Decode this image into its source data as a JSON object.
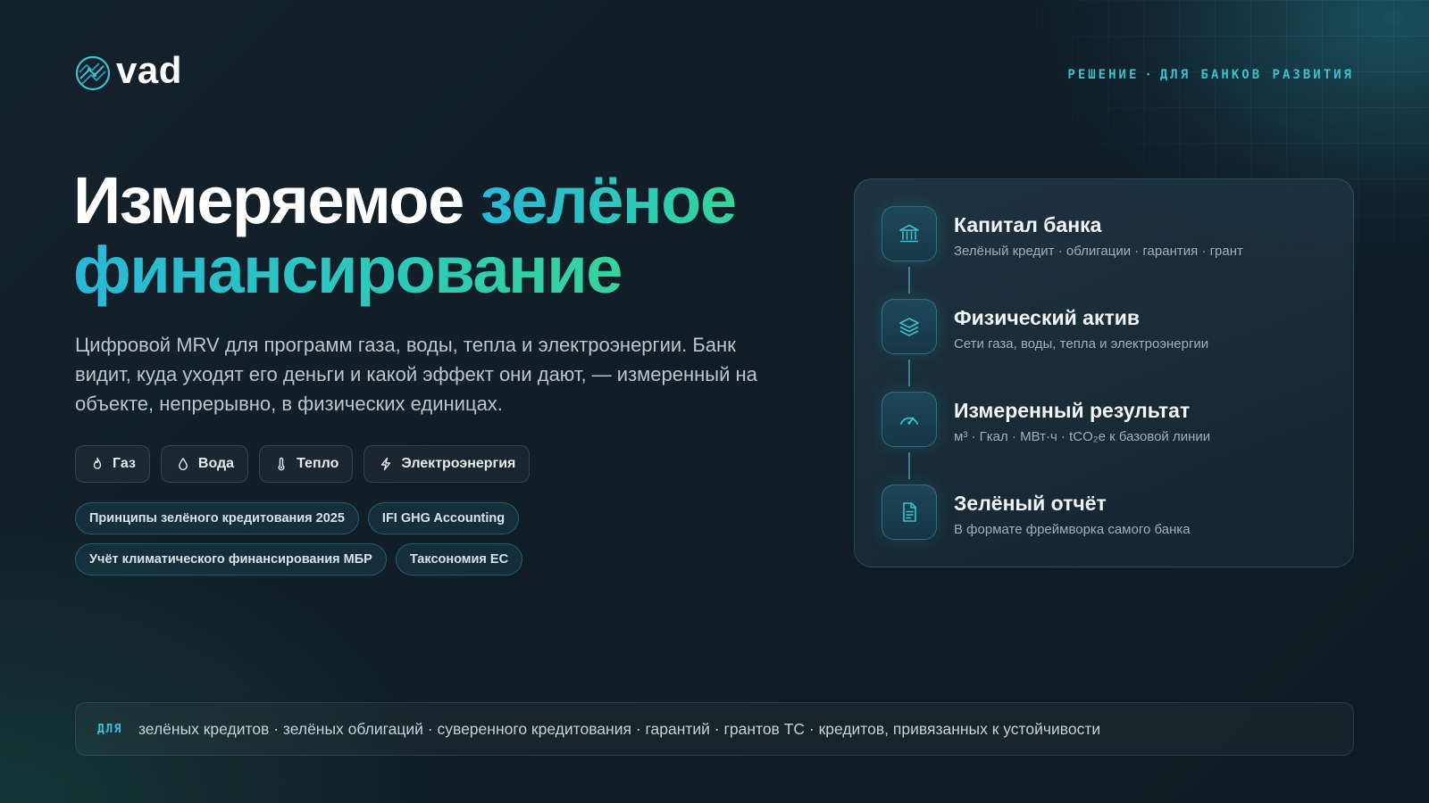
{
  "brand": {
    "name": "vad",
    "icon": "globe-network-icon"
  },
  "header": {
    "tag_left": "РЕШЕНИЕ",
    "tag_sep": "·",
    "tag_right": "ДЛЯ БАНКОВ РАЗВИТИЯ"
  },
  "hero": {
    "title_white": "Измеряемое ",
    "title_accent_1": "зелёное",
    "title_accent_2": "финансирование",
    "lead": "Цифровой MRV для программ газа, воды, тепла и электроэнергии. Банк видит, куда уходят его деньги и какой эффект они дают, — измеренный на объекте, непрерывно, в физических единицах."
  },
  "resources": [
    {
      "label": "Газ",
      "icon": "flame-icon"
    },
    {
      "label": "Вода",
      "icon": "droplet-icon"
    },
    {
      "label": "Тепло",
      "icon": "thermometer-icon"
    },
    {
      "label": "Электроэнергия",
      "icon": "lightning-icon"
    }
  ],
  "standards": [
    "Принципы зелёного кредитования 2025",
    "IFI GHG Accounting",
    "Учёт климатического финансирования МБР",
    "Таксономия ЕС"
  ],
  "flow": [
    {
      "title": "Капитал банка",
      "subtitle": "Зелёный кредит · облигации · гарантия · грант",
      "icon": "bank-icon"
    },
    {
      "title": "Физический актив",
      "subtitle": "Сети газа, воды, тепла и электроэнергии",
      "icon": "layers-icon"
    },
    {
      "title": "Измеренный результат",
      "subtitle": "м³ · Гкал · МВт·ч · tCO₂e к базовой линии",
      "icon": "gauge-icon"
    },
    {
      "title": "Зелёный отчёт",
      "subtitle": "В формате фреймворка самого банка",
      "icon": "document-icon"
    }
  ],
  "footer": {
    "label": "ДЛЯ",
    "text": "зелёных кредитов · зелёных облигаций · суверенного кредитования · гарантий · грантов ТС · кредитов, привязанных к устойчивости"
  },
  "colors": {
    "accent_cyan": "#2ab8d8",
    "accent_green": "#36d49a",
    "tag": "#3cc0d0",
    "background": "#12202a"
  }
}
